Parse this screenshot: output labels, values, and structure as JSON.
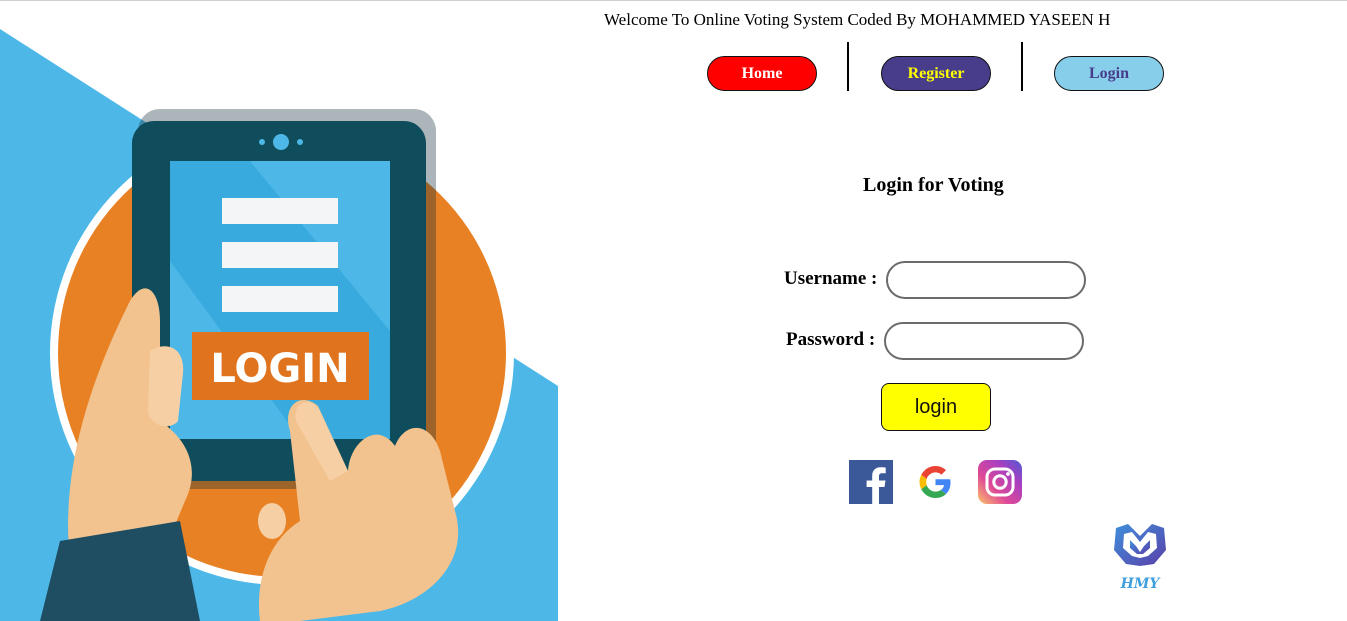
{
  "header": {
    "welcome_text": "Welcome To Online Voting System Coded By MOHAMMED YASEEN H"
  },
  "nav": {
    "home_label": "Home",
    "register_label": "Register",
    "login_label": "Login"
  },
  "hero": {
    "screen_text": "LOGIN"
  },
  "form": {
    "title": "Login for Voting",
    "username_label": "Username :",
    "username_value": "",
    "password_label": "Password :",
    "password_value": "",
    "submit_label": "login"
  },
  "social": {
    "icons": [
      "facebook-icon",
      "google-icon",
      "instagram-icon"
    ]
  },
  "brand": {
    "logo_text": "HMY"
  },
  "colors": {
    "home_bg": "#ff0000",
    "register_bg": "#483d8b",
    "register_text": "#ffff00",
    "login_bg": "#87ceeb",
    "submit_bg": "#ffff00",
    "hero_blue": "#4db8e8",
    "hero_orange": "#e88124"
  }
}
